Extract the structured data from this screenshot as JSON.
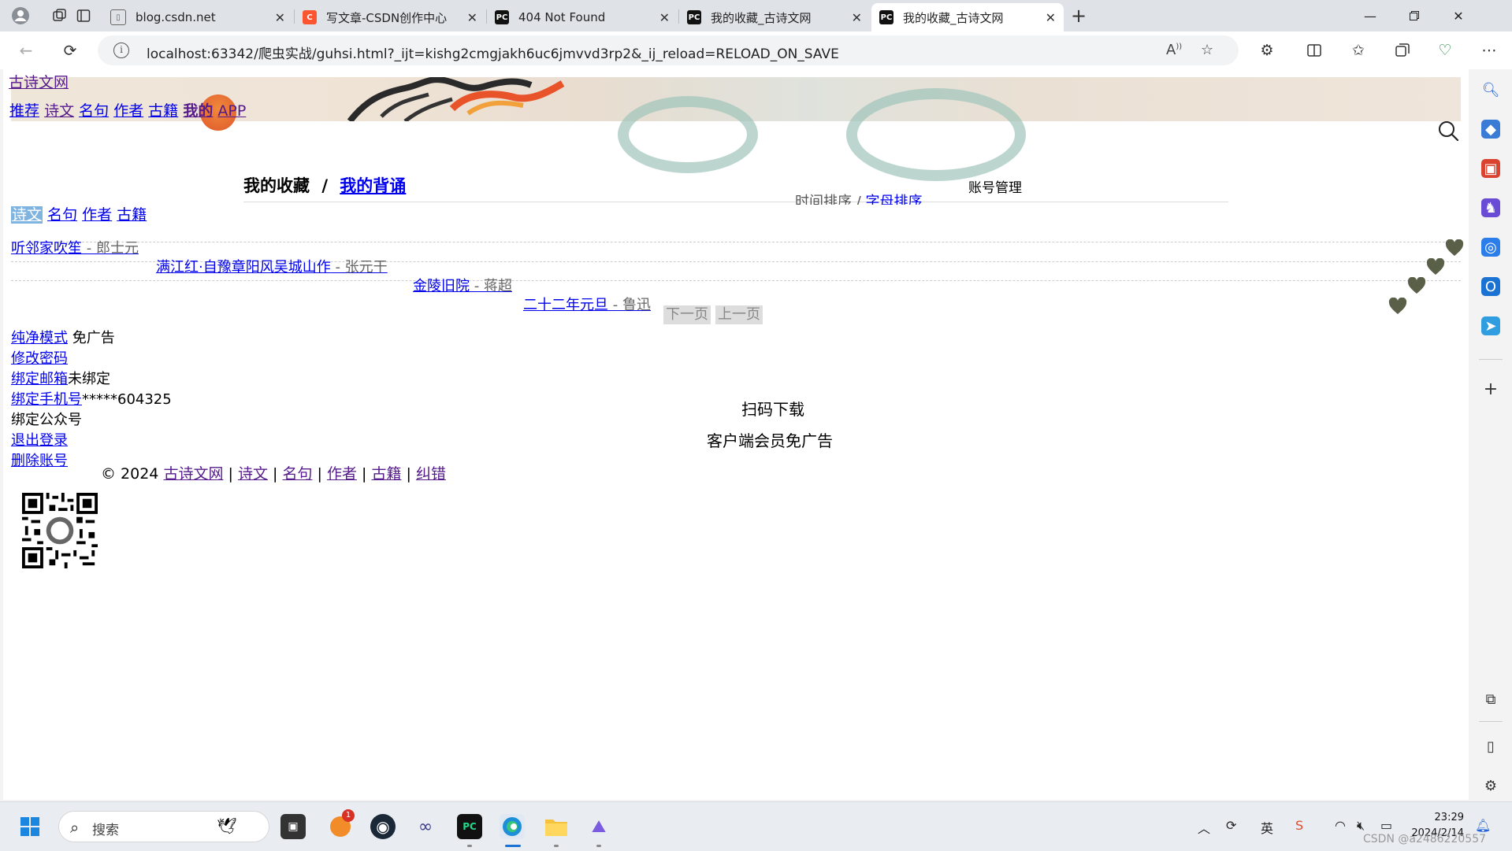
{
  "tabs": [
    {
      "label": "blog.csdn.net",
      "favicon": "page-icon",
      "active": false
    },
    {
      "label": "写文章-CSDN创作中心",
      "favicon": "csdn-icon",
      "active": false
    },
    {
      "label": "404 Not Found",
      "favicon": "pycharm-icon",
      "active": false
    },
    {
      "label": "我的收藏_古诗文网",
      "favicon": "pycharm-icon",
      "active": false
    },
    {
      "label": "我的收藏_古诗文网",
      "favicon": "pycharm-icon",
      "active": true
    }
  ],
  "tab_close": "✕",
  "new_tab": "+",
  "address": {
    "url": "localhost:63342/爬虫实战/guhsi.html?_ijt=kishg2cmgjakh6uc6jmvvd3rp2&_ij_reload=RELOAD_ON_SAVE"
  },
  "site": {
    "logo": "古诗文网",
    "nav": [
      "推荐",
      "诗文",
      "名句",
      "作者",
      "古籍",
      "我的",
      "APP"
    ]
  },
  "collection": {
    "title": "我的收藏",
    "separator": "/",
    "recite_link": "我的背诵",
    "sort_time": "时间排序",
    "sort_sep": "/",
    "sort_alpha": "字母排序",
    "account_title": "账号管理",
    "filters": [
      "诗文",
      "名句",
      "作者",
      "古籍"
    ],
    "items": [
      {
        "title": "听邻家吹笙",
        "author": " - 郎士元"
      },
      {
        "title": "满江红·自豫章阳风吴城山作",
        "author": " - 张元干"
      },
      {
        "title": "金陵旧院",
        "author": " - 蒋超"
      },
      {
        "title": "二十二年元旦",
        "author": " - 鲁迅"
      }
    ],
    "next_page": "下一页",
    "prev_page": "上一页"
  },
  "account": {
    "pure_mode": "纯净模式",
    "pure_mode_note": " 免广告",
    "change_password": "修改密码",
    "bind_email": "绑定邮箱",
    "bind_email_status": "未绑定",
    "bind_phone": "绑定手机号",
    "bind_phone_value": "*****604325",
    "bind_wechat": "绑定公众号",
    "logout": "退出登录",
    "delete_account": "删除账号"
  },
  "download": {
    "scan": "扫码下载",
    "vip": "客户端会员免广告"
  },
  "footer": {
    "copyright": "© 2024 ",
    "links": [
      "古诗文网",
      "诗文",
      "名句",
      "作者",
      "古籍",
      "纠错"
    ],
    "sep": " | "
  },
  "taskbar": {
    "search_placeholder": "搜索",
    "badge": "1",
    "time": "23:29",
    "date": "2024/2/14",
    "ime": "英"
  },
  "watermark": "CSDN @a2486220557",
  "colors": {
    "link": "#0000ee",
    "visited": "#551a8b",
    "heart": "#5a6048",
    "filter_active_bg": "#7fb3e0"
  }
}
